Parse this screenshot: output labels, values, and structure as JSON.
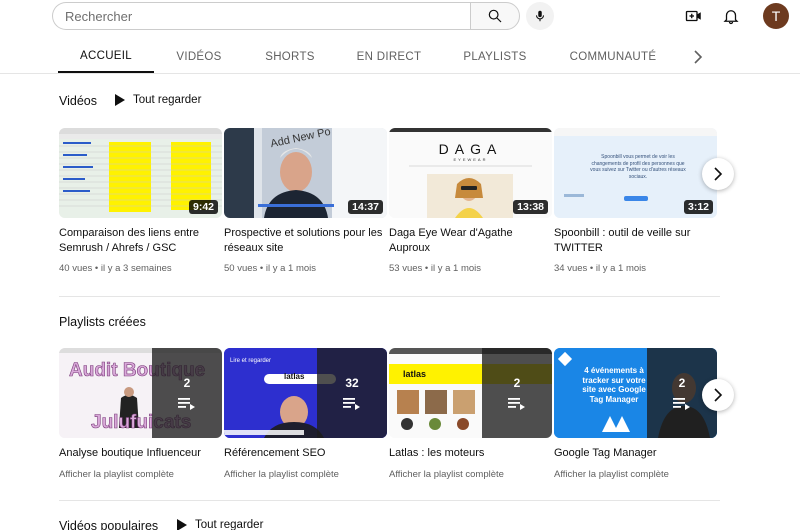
{
  "search": {
    "placeholder": "Rechercher"
  },
  "user": {
    "avatar_letter": "T",
    "avatar_color": "#6d3a1f"
  },
  "tabs": [
    {
      "label": "ACCUEIL",
      "active": true
    },
    {
      "label": "VIDÉOS",
      "active": false
    },
    {
      "label": "SHORTS",
      "active": false
    },
    {
      "label": "EN DIRECT",
      "active": false
    },
    {
      "label": "PLAYLISTS",
      "active": false
    },
    {
      "label": "COMMUNAUTÉ",
      "active": false
    }
  ],
  "videos_section": {
    "title": "Vidéos",
    "play_all": "Tout regarder",
    "items": [
      {
        "title": "Comparaison des liens entre Semrush / Ahrefs / GSC",
        "duration": "9:42",
        "meta": "40 vues • il y a 3 semaines"
      },
      {
        "title": "Prospective et solutions pour les réseaux site",
        "duration": "14:37",
        "meta": "50 vues • il y a 1 mois",
        "thumb_text": "Add New Po"
      },
      {
        "title": "Daga Eye Wear d'Agathe Auproux",
        "duration": "13:38",
        "meta": "53 vues • il y a 1 mois",
        "thumb_text": "DAGA",
        "thumb_subtext": "EYEWEAR"
      },
      {
        "title": "Spoonbill : outil de veille sur TWITTER",
        "duration": "3:12",
        "meta": "34 vues • il y a 1 mois",
        "thumb_text": "Spoonbill vous permet de voir les changements de profil des personnes que vous suivez sur Twitter ou d'autres réseaux sociaux."
      }
    ]
  },
  "playlists_section": {
    "title": "Playlists créées",
    "items": [
      {
        "title": "Analyse boutique Influenceur",
        "count": "2",
        "link": "Afficher la playlist complète",
        "thumb_text": "Audit Boutique",
        "thumb_text2": "Julufuicats"
      },
      {
        "title": "Référencement SEO",
        "count": "32",
        "link": "Afficher la playlist complète",
        "thumb_text": "Lire et regarder",
        "thumb_text2": "latlas"
      },
      {
        "title": "Latlas : les moteurs",
        "count": "2",
        "link": "Afficher la playlist complète",
        "thumb_text": "latlas"
      },
      {
        "title": "Google Tag Manager",
        "count": "2",
        "link": "Afficher la playlist complète",
        "thumb_text": "4 événements à tracker sur votre site avec Google Tag Manager"
      }
    ]
  },
  "popular_section": {
    "title": "Vidéos populaires",
    "play_all": "Tout regarder"
  }
}
